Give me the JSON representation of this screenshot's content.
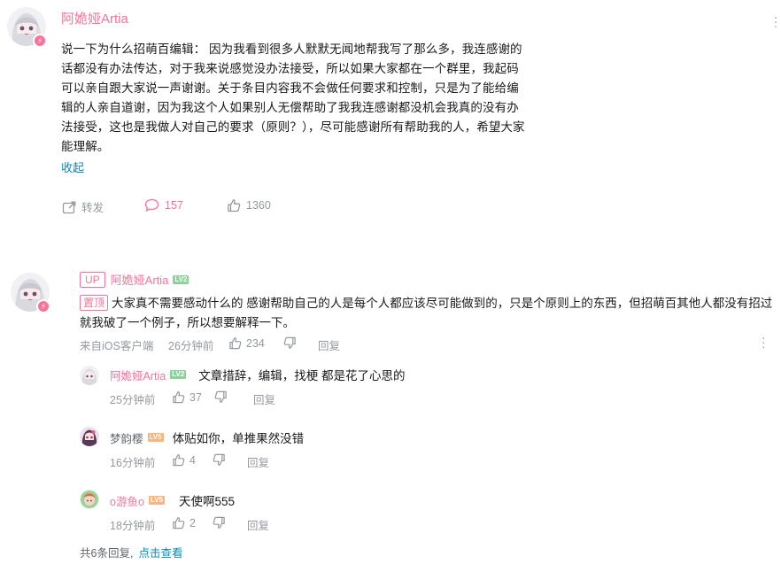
{
  "main_comment": {
    "username": "阿姽娅Artia",
    "text": "说一下为什么招萌百编辑： 因为我看到很多人默默无闻地帮我写了那么多，我连感谢的话都没有办法传达，对于我来说感觉没办法接受，所以如果大家都在一个群里，我起码可以亲自跟大家说一声谢谢。关于条目内容我不会做任何要求和控制，只是为了能给编辑的人亲自道谢，因为我这个人如果别人无偿帮助了我我连感谢都没机会我真的没有办法接受，这也是我做人对自己的要求（原则？），尽可能感谢所有帮助我的人，希望大家能理解。",
    "collapse_label": "收起",
    "share_label": "转发",
    "comment_count": "157",
    "like_count": "1360"
  },
  "reply": {
    "up_tag": "UP",
    "username": "阿姽娅Artia",
    "level": "LV2",
    "pin_tag": "置顶",
    "text": "大家真不需要感动什么的 感谢帮助自己的人是每个人都应该尽可能做到的，只是个原则上的东西，但招萌百其他人都没有招过就我破了一个例子，所以想要解释一下。",
    "source": "来自iOS客户端",
    "time": "26分钟前",
    "likes": "234",
    "reply_label": "回复"
  },
  "sub_replies": [
    {
      "username": "阿姽娅Artia",
      "level": "LV2",
      "text": "文章措辞，编辑，找梗 都是花了心思的",
      "time": "25分钟前",
      "likes": "37",
      "reply_label": "回复",
      "name_color": "#fb7299"
    },
    {
      "username": "梦韵樱",
      "level": "LV5",
      "text": "体贴如你，单推果然没错",
      "time": "16分钟前",
      "likes": "4",
      "reply_label": "回复",
      "name_color": "#61666d"
    },
    {
      "username": "o游鱼o",
      "level": "LV5",
      "text": "天使啊555",
      "time": "18分钟前",
      "likes": "2",
      "reply_label": "回复",
      "name_color": "#fb7299"
    }
  ],
  "footer": {
    "count_text": "共6条回复,",
    "view_link": "点击查看"
  },
  "icons": {
    "share": "share-icon",
    "comment": "comment-icon",
    "like": "thumbs-up-icon",
    "dislike": "thumbs-down-icon",
    "more": "more-vertical-icon",
    "bolt": "lightning-badge-icon"
  },
  "colors": {
    "accent_pink": "#fb7299",
    "link_blue": "#008ac5",
    "muted": "#9499a0",
    "lv2": "#8bd29b",
    "lv5": "#ffb37c"
  }
}
